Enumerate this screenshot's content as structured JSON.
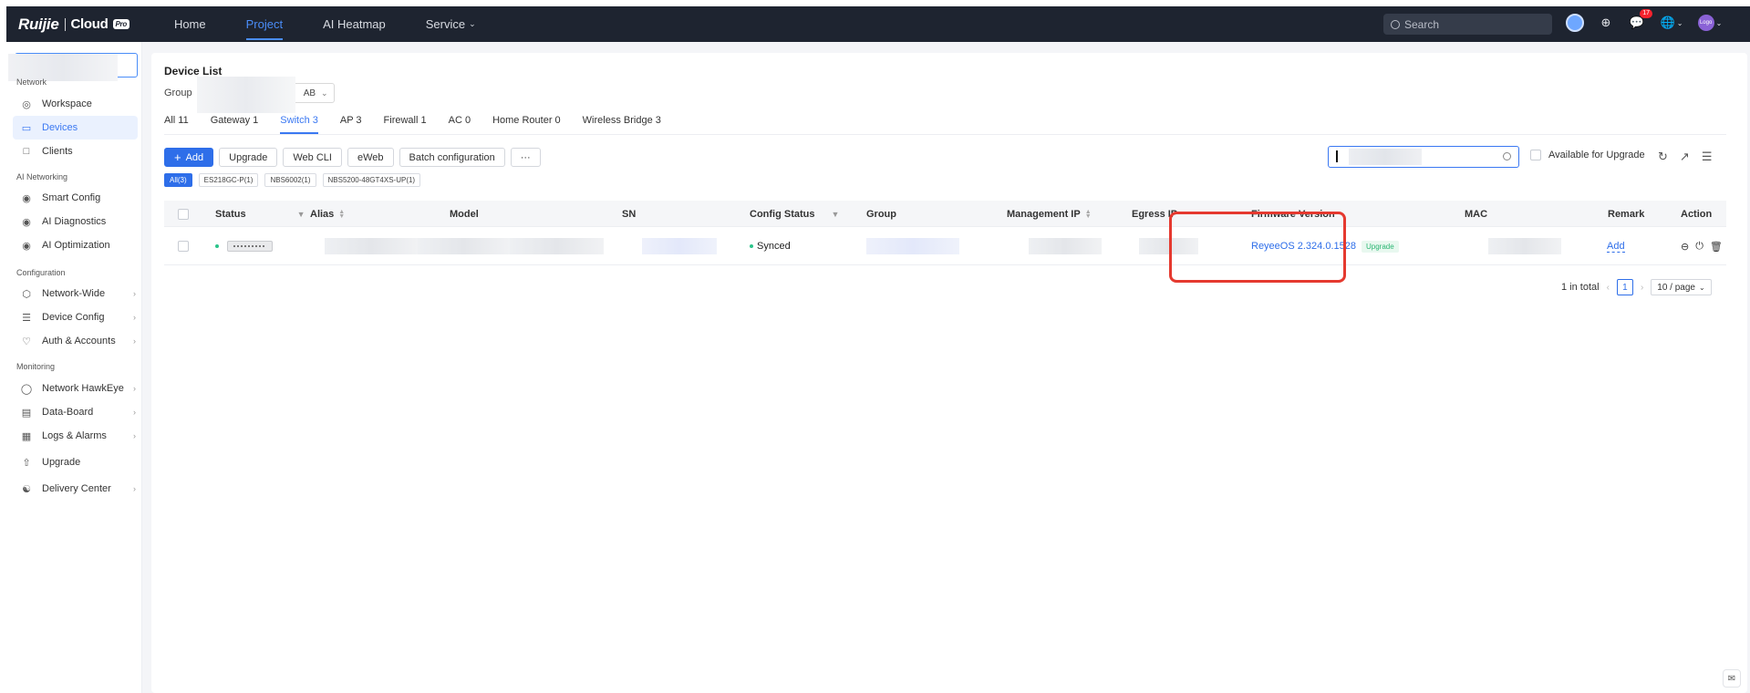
{
  "header": {
    "brand": "Ruijie",
    "brand_cloud": "Cloud",
    "brand_pro": "Pro",
    "nav": [
      {
        "label": "Home"
      },
      {
        "label": "Project"
      },
      {
        "label": "AI Heatmap"
      },
      {
        "label": "Service"
      }
    ],
    "search_placeholder": "Search",
    "notification_count": "17",
    "avatar_text": "Logo"
  },
  "sidebar": {
    "sections": {
      "network": "Network",
      "ai_networking": "AI Networking",
      "configuration": "Configuration",
      "monitoring": "Monitoring"
    },
    "items": {
      "workspace": "Workspace",
      "devices": "Devices",
      "clients": "Clients",
      "smart_config": "Smart Config",
      "ai_diagnostics": "AI Diagnostics",
      "ai_optimization": "AI Optimization",
      "network_wide": "Network-Wide",
      "device_config": "Device Config",
      "auth_accounts": "Auth & Accounts",
      "network_hawkeye": "Network HawkEye",
      "data_board": "Data-Board",
      "logs_alarms": "Logs & Alarms",
      "upgrade": "Upgrade",
      "delivery_center": "Delivery Center"
    }
  },
  "main": {
    "title": "Device List",
    "group_label": "Group",
    "group_value_suffix": "AB",
    "tabs": [
      {
        "label": "All 11"
      },
      {
        "label": "Gateway 1"
      },
      {
        "label": "Switch 3"
      },
      {
        "label": "AP 3"
      },
      {
        "label": "Firewall 1"
      },
      {
        "label": "AC 0"
      },
      {
        "label": "Home Router 0"
      },
      {
        "label": "Wireless Bridge 3"
      }
    ],
    "toolbar": {
      "add": "Add",
      "upgrade": "Upgrade",
      "web_cli": "Web CLI",
      "eweb": "eWeb",
      "batch_config": "Batch configuration",
      "more": "···"
    },
    "available_for_upgrade": "Available for Upgrade",
    "chips": [
      "All(3)",
      "ES218GC-P(1)",
      "NBS6002(1)",
      "NBS5200-48GT4XS-UP(1)"
    ],
    "table": {
      "columns": {
        "status": "Status",
        "alias": "Alias",
        "model": "Model",
        "sn": "SN",
        "config_status": "Config Status",
        "group": "Group",
        "management_ip": "Management IP",
        "egress_ip": "Egress IP",
        "firmware_version": "Firmware Version",
        "mac": "MAC",
        "remark": "Remark",
        "action": "Action"
      },
      "row": {
        "config_status": "Synced",
        "firmware_version": "ReyeeOS 2.324.0.1528",
        "firmware_tag": "Upgrade",
        "remark": "Add"
      }
    },
    "pagination": {
      "total": "1 in total",
      "page": "1",
      "page_size": "10 / page"
    }
  },
  "colors": {
    "accent": "#2e6ee9",
    "highlight_box": "#e5392f",
    "success": "#2bc48a"
  }
}
